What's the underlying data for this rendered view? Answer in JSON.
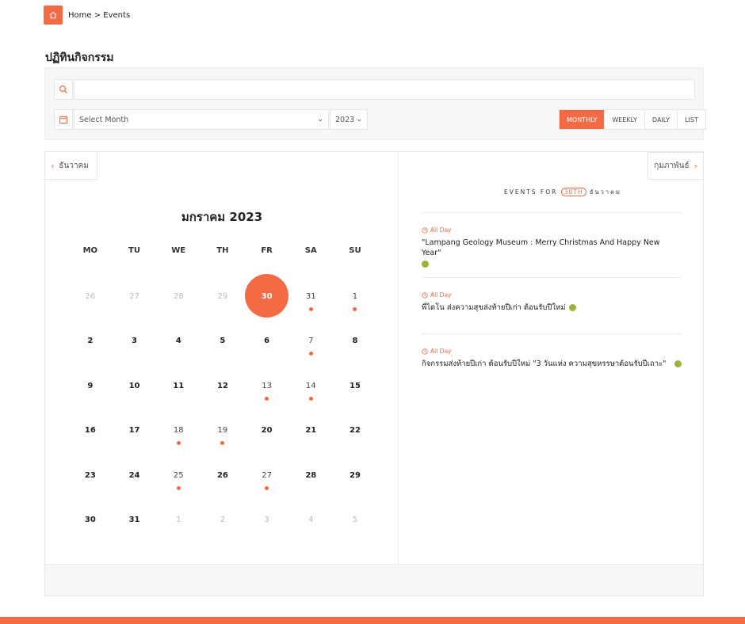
{
  "breadcrumb": {
    "home": "Home",
    "separator": ">",
    "current": "Events"
  },
  "page_title": "ปฏิทินกิจกรรม",
  "filters": {
    "search_value": "",
    "month_placeholder": "Select Month",
    "year": "2023"
  },
  "view_tabs": [
    {
      "label": "MONTHLY",
      "active": true
    },
    {
      "label": "WEEKLY",
      "active": false
    },
    {
      "label": "DAILY",
      "active": false
    },
    {
      "label": "LIST",
      "active": false
    }
  ],
  "calendar": {
    "prev_month": "ธันวาคม",
    "next_month": "กุมภาพันธ์",
    "title": "มกราคม 2023",
    "weekdays": [
      "MO",
      "TU",
      "WE",
      "TH",
      "FR",
      "SA",
      "SU"
    ],
    "days": [
      {
        "n": "26",
        "muted": true
      },
      {
        "n": "27",
        "muted": true
      },
      {
        "n": "28",
        "muted": true
      },
      {
        "n": "29",
        "muted": true
      },
      {
        "n": "30",
        "today": true
      },
      {
        "n": "31",
        "event": true
      },
      {
        "n": "1",
        "event": true
      },
      {
        "n": "2"
      },
      {
        "n": "3"
      },
      {
        "n": "4"
      },
      {
        "n": "5"
      },
      {
        "n": "6"
      },
      {
        "n": "7",
        "event": true
      },
      {
        "n": "8"
      },
      {
        "n": "9"
      },
      {
        "n": "10"
      },
      {
        "n": "11"
      },
      {
        "n": "12"
      },
      {
        "n": "13",
        "event": true
      },
      {
        "n": "14",
        "event": true
      },
      {
        "n": "15"
      },
      {
        "n": "16"
      },
      {
        "n": "17"
      },
      {
        "n": "18",
        "event": true
      },
      {
        "n": "19",
        "event": true
      },
      {
        "n": "20"
      },
      {
        "n": "21"
      },
      {
        "n": "22"
      },
      {
        "n": "23"
      },
      {
        "n": "24"
      },
      {
        "n": "25",
        "event": true
      },
      {
        "n": "26"
      },
      {
        "n": "27",
        "event": true
      },
      {
        "n": "28"
      },
      {
        "n": "29"
      },
      {
        "n": "30"
      },
      {
        "n": "31"
      },
      {
        "n": "1",
        "muted": true
      },
      {
        "n": "2",
        "muted": true
      },
      {
        "n": "3",
        "muted": true
      },
      {
        "n": "4",
        "muted": true
      },
      {
        "n": "5",
        "muted": true
      }
    ]
  },
  "events_panel": {
    "heading_prefix": "EVENTS FOR",
    "heading_date": "30TH",
    "heading_month": "ธันวาคม",
    "items": [
      {
        "time": "All Day",
        "title": "\"Lampang Geology Museum : Merry Christmas And Happy New Year\""
      },
      {
        "time": "All Day",
        "title": "พี่ไดโน ส่งความสุขส่งท้ายปีเก่า ต้อนรับปีใหม่"
      },
      {
        "time": "All Day",
        "title": "กิจกรรมส่งท้ายปีเก่า ต้อนรับปีใหม่ \"3 วันแห่ง ความสุขหรรษาต้อนรับปีเถาะ\""
      }
    ]
  },
  "colors": {
    "accent": "#f26b45",
    "event_category": "#9cb33c"
  }
}
